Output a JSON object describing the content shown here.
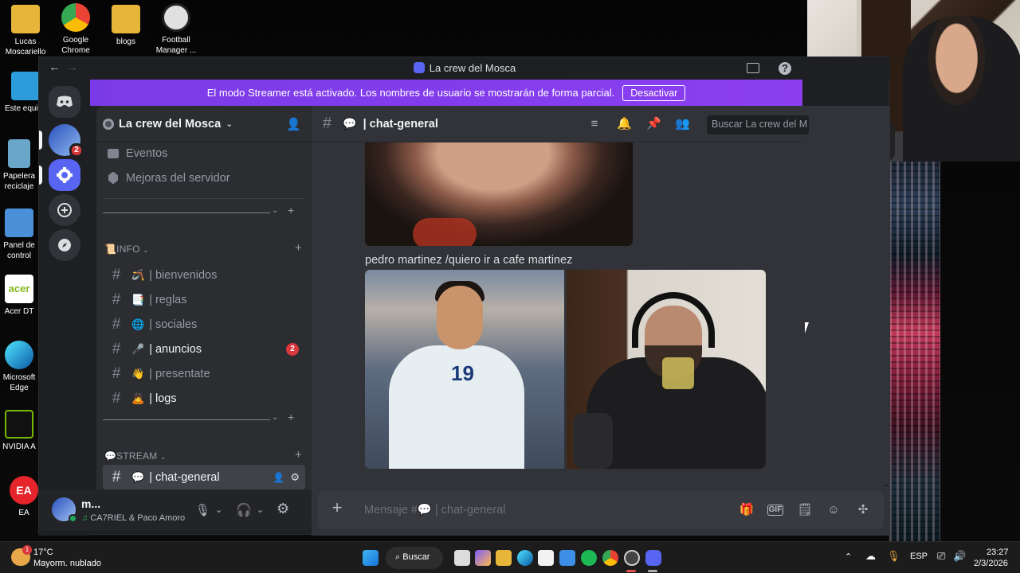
{
  "desktop": {
    "icons": [
      {
        "label": "Lucas Moscariello",
        "color": "#e8b53b"
      },
      {
        "label": "Google Chrome",
        "color": "#4285f4"
      },
      {
        "label": "blogs",
        "color": "#e8b53b"
      },
      {
        "label": "Football Manager ...",
        "color": "#e0e0e0"
      },
      {
        "label": "Este equi",
        "color": "#2d9cdb"
      },
      {
        "label": "Papelera reciclaje",
        "color": "#6aa6c9"
      },
      {
        "label": "Panel de control",
        "color": "#4a90d9"
      },
      {
        "label": "Acer DT",
        "color": "#83b81a"
      },
      {
        "label": "Microsoft Edge",
        "color": "#0c8ad8"
      },
      {
        "label": "NVIDIA A",
        "color": "#76b900"
      },
      {
        "label": "EA",
        "color": "#e5242b"
      }
    ]
  },
  "window": {
    "title": "La crew del Mosca",
    "back": "←",
    "forward": "→"
  },
  "banner": {
    "text": "El modo Streamer está activado. Los nombres de usuario se mostrarán de forma parcial.",
    "button": "Desactivar"
  },
  "guilds": {
    "mention_count": "2"
  },
  "server": {
    "name": "La crew del Mosca",
    "top_items": [
      "Eventos",
      "Mejoras del servidor"
    ],
    "categories": [
      {
        "name": "INFO",
        "emoji": "📜"
      },
      {
        "name": "STREAM",
        "emoji": "💬"
      }
    ],
    "channels": [
      {
        "emoji": "🪃",
        "name": "| bienvenidos"
      },
      {
        "emoji": "📑",
        "name": "| reglas"
      },
      {
        "emoji": "🌐",
        "name": "| sociales"
      },
      {
        "emoji": "🎤",
        "name": "| anuncios",
        "badge": "2"
      },
      {
        "emoji": "👋",
        "name": "| presentate"
      },
      {
        "emoji": "🙇",
        "name": "| logs"
      },
      {
        "emoji": "💬",
        "name": "| chat-general"
      }
    ]
  },
  "user": {
    "name": "m...",
    "status": "CA7RIEL & Paco Amoro"
  },
  "chat": {
    "channel": "| chat-general",
    "search_placeholder": "Buscar La crew del M",
    "message_text": "pedro martinez /quiero ir a cafe martinez",
    "jersey_number": "19",
    "composer_placeholder": "Mensaje #💬 | chat-general"
  },
  "taskbar": {
    "weather_temp": "17°C",
    "weather_desc": "Mayorm. nublado",
    "weather_badge": "1",
    "search_label": "Buscar",
    "lang": "ESP",
    "time": "23:27",
    "date": "2/3/2026"
  }
}
